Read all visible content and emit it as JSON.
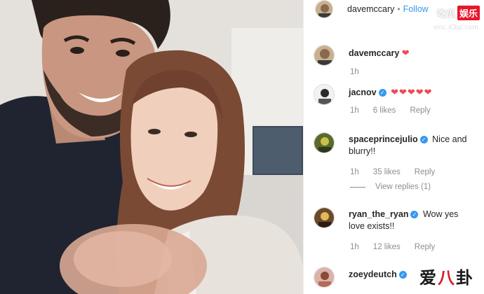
{
  "header": {
    "username": "davemccary",
    "separator": "•",
    "follow_label": "Follow"
  },
  "watermarks": {
    "top_left": "吃瓜",
    "top_right": "娱乐",
    "url": "enc.43ip.com",
    "bottom": [
      "爱",
      "八",
      "卦"
    ]
  },
  "comments": [
    {
      "username": "davemccary",
      "verified": false,
      "text": "",
      "hearts": "❤",
      "time": "1h",
      "likes": "",
      "reply": ""
    },
    {
      "username": "jacnov",
      "verified": true,
      "text": "",
      "hearts": "❤❤❤❤❤",
      "time": "1h",
      "likes": "6 likes",
      "reply": "Reply"
    },
    {
      "username": "spaceprincejulio",
      "verified": true,
      "text": "Nice and blurry!!",
      "hearts": "",
      "time": "1h",
      "likes": "35 likes",
      "reply": "Reply",
      "view_replies": "View replies (1)"
    },
    {
      "username": "ryan_the_ryan",
      "verified": true,
      "text": "Wow yes love exists!!",
      "hearts": "",
      "time": "1h",
      "likes": "12 likes",
      "reply": "Reply"
    },
    {
      "username": "zoeydeutch",
      "verified": true,
      "text": "",
      "hearts": "",
      "time": "",
      "likes": "",
      "reply": ""
    }
  ],
  "colors": {
    "link_blue": "#3897f0",
    "heart_red": "#ed4956",
    "meta_gray": "#8e8e8e",
    "watermark_red": "#e8152b"
  }
}
